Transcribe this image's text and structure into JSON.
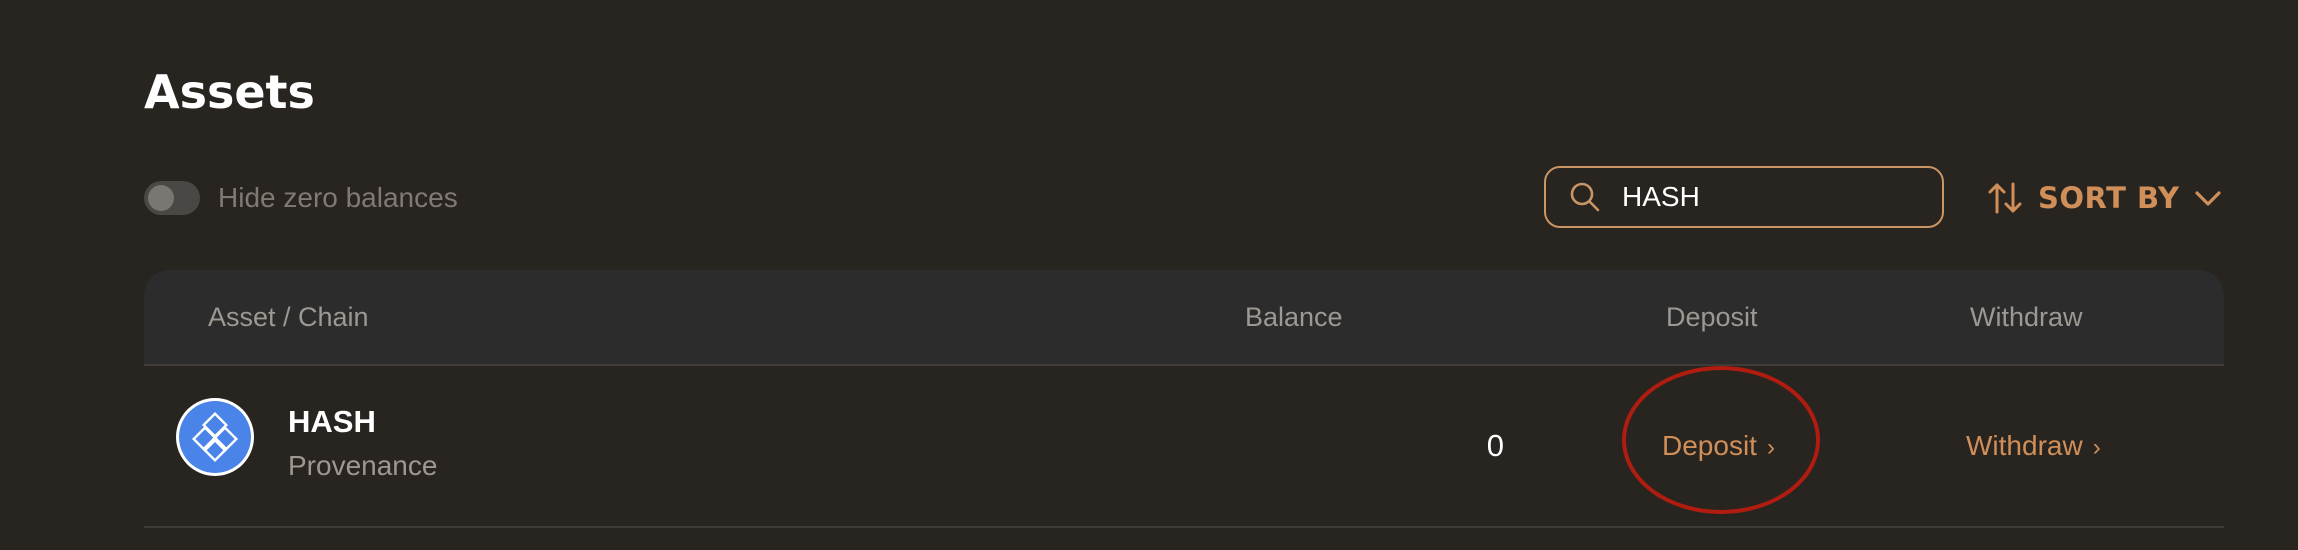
{
  "page": {
    "title": "Assets"
  },
  "filters": {
    "hide_zero_label": "Hide zero balances",
    "hide_zero_enabled": false
  },
  "search": {
    "value": "HASH",
    "icon": "search-icon"
  },
  "sort": {
    "label": "SORT BY",
    "icon": "sort-arrows-icon",
    "chevron": "chevron-down-icon"
  },
  "table": {
    "columns": {
      "asset": "Asset / Chain",
      "balance": "Balance",
      "deposit": "Deposit",
      "withdraw": "Withdraw"
    },
    "rows": [
      {
        "icon": "hash-token-icon",
        "name": "HASH",
        "chain": "Provenance",
        "balance": "0",
        "deposit_label": "Deposit",
        "withdraw_label": "Withdraw",
        "action_arrow": "›"
      }
    ]
  },
  "colors": {
    "background": "#282420",
    "accent": "#d08f58",
    "header_bg": "#2d2c2c",
    "token_blue": "#4a84e8",
    "annotation_red": "#b01d10"
  }
}
